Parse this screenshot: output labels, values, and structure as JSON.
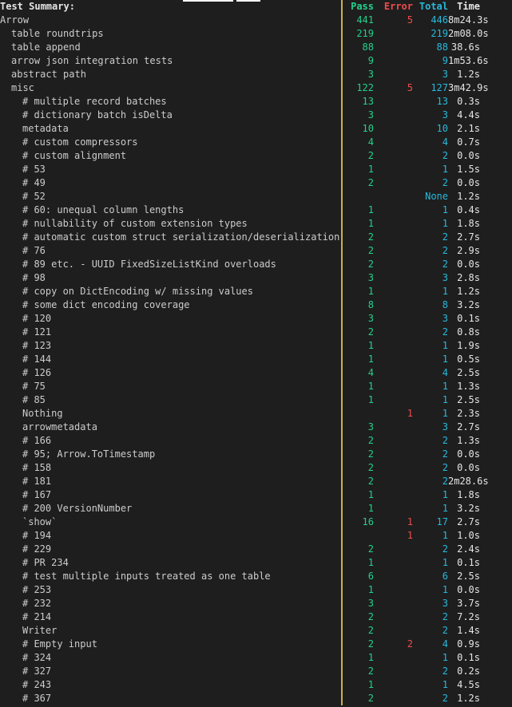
{
  "header": {
    "title": "Test Summary:",
    "pass": "Pass",
    "error": "Error",
    "total": "Total",
    "time": "Time"
  },
  "rows": [
    {
      "name": "Arrow",
      "indent": 0,
      "pass": "441",
      "error": "5",
      "total": "446",
      "time": "8m24.3s"
    },
    {
      "name": "table roundtrips",
      "indent": 1,
      "pass": "219",
      "error": "",
      "total": "219",
      "time": "2m08.0s"
    },
    {
      "name": "table append",
      "indent": 1,
      "pass": "88",
      "error": "",
      "total": "88",
      "time": "38.6s"
    },
    {
      "name": "arrow json integration tests",
      "indent": 1,
      "pass": "9",
      "error": "",
      "total": "9",
      "time": "1m53.6s"
    },
    {
      "name": "abstract path",
      "indent": 1,
      "pass": "3",
      "error": "",
      "total": "3",
      "time": "1.2s"
    },
    {
      "name": "misc",
      "indent": 1,
      "pass": "122",
      "error": "5",
      "total": "127",
      "time": "3m42.9s"
    },
    {
      "name": "# multiple record batches",
      "indent": 2,
      "pass": "13",
      "error": "",
      "total": "13",
      "time": "0.3s"
    },
    {
      "name": "# dictionary batch isDelta",
      "indent": 2,
      "pass": "3",
      "error": "",
      "total": "3",
      "time": "4.4s"
    },
    {
      "name": "metadata",
      "indent": 2,
      "pass": "10",
      "error": "",
      "total": "10",
      "time": "2.1s"
    },
    {
      "name": "# custom compressors",
      "indent": 2,
      "pass": "4",
      "error": "",
      "total": "4",
      "time": "0.7s"
    },
    {
      "name": "# custom alignment",
      "indent": 2,
      "pass": "2",
      "error": "",
      "total": "2",
      "time": "0.0s"
    },
    {
      "name": "# 53",
      "indent": 2,
      "pass": "1",
      "error": "",
      "total": "1",
      "time": "1.5s"
    },
    {
      "name": "# 49",
      "indent": 2,
      "pass": "2",
      "error": "",
      "total": "2",
      "time": "0.0s"
    },
    {
      "name": "# 52",
      "indent": 2,
      "pass": "",
      "error": "",
      "total": "None",
      "time": "1.2s"
    },
    {
      "name": "# 60: unequal column lengths",
      "indent": 2,
      "pass": "1",
      "error": "",
      "total": "1",
      "time": "0.4s"
    },
    {
      "name": "# nullability of custom extension types",
      "indent": 2,
      "pass": "1",
      "error": "",
      "total": "1",
      "time": "1.8s"
    },
    {
      "name": "# automatic custom struct serialization/deserialization",
      "indent": 2,
      "pass": "2",
      "error": "",
      "total": "2",
      "time": "2.7s"
    },
    {
      "name": "# 76",
      "indent": 2,
      "pass": "2",
      "error": "",
      "total": "2",
      "time": "2.9s"
    },
    {
      "name": "# 89 etc. - UUID FixedSizeListKind overloads",
      "indent": 2,
      "pass": "2",
      "error": "",
      "total": "2",
      "time": "0.0s"
    },
    {
      "name": "# 98",
      "indent": 2,
      "pass": "3",
      "error": "",
      "total": "3",
      "time": "2.8s"
    },
    {
      "name": "# copy on DictEncoding w/ missing values",
      "indent": 2,
      "pass": "1",
      "error": "",
      "total": "1",
      "time": "1.2s"
    },
    {
      "name": "# some dict encoding coverage",
      "indent": 2,
      "pass": "8",
      "error": "",
      "total": "8",
      "time": "3.2s"
    },
    {
      "name": "# 120",
      "indent": 2,
      "pass": "3",
      "error": "",
      "total": "3",
      "time": "0.1s"
    },
    {
      "name": "# 121",
      "indent": 2,
      "pass": "2",
      "error": "",
      "total": "2",
      "time": "0.8s"
    },
    {
      "name": "# 123",
      "indent": 2,
      "pass": "1",
      "error": "",
      "total": "1",
      "time": "1.9s"
    },
    {
      "name": "# 144",
      "indent": 2,
      "pass": "1",
      "error": "",
      "total": "1",
      "time": "0.5s"
    },
    {
      "name": "# 126",
      "indent": 2,
      "pass": "4",
      "error": "",
      "total": "4",
      "time": "2.5s"
    },
    {
      "name": "# 75",
      "indent": 2,
      "pass": "1",
      "error": "",
      "total": "1",
      "time": "1.3s"
    },
    {
      "name": "# 85",
      "indent": 2,
      "pass": "1",
      "error": "",
      "total": "1",
      "time": "2.5s"
    },
    {
      "name": "Nothing",
      "indent": 2,
      "pass": "",
      "error": "1",
      "total": "1",
      "time": "2.3s"
    },
    {
      "name": "arrowmetadata",
      "indent": 2,
      "pass": "3",
      "error": "",
      "total": "3",
      "time": "2.7s"
    },
    {
      "name": "# 166",
      "indent": 2,
      "pass": "2",
      "error": "",
      "total": "2",
      "time": "1.3s"
    },
    {
      "name": "# 95; Arrow.ToTimestamp",
      "indent": 2,
      "pass": "2",
      "error": "",
      "total": "2",
      "time": "0.0s"
    },
    {
      "name": "# 158",
      "indent": 2,
      "pass": "2",
      "error": "",
      "total": "2",
      "time": "0.0s"
    },
    {
      "name": "# 181",
      "indent": 2,
      "pass": "2",
      "error": "",
      "total": "2",
      "time": "2m28.6s"
    },
    {
      "name": "# 167",
      "indent": 2,
      "pass": "1",
      "error": "",
      "total": "1",
      "time": "1.8s"
    },
    {
      "name": "# 200 VersionNumber",
      "indent": 2,
      "pass": "1",
      "error": "",
      "total": "1",
      "time": "3.2s"
    },
    {
      "name": "`show`",
      "indent": 2,
      "pass": "16",
      "error": "1",
      "total": "17",
      "time": "2.7s"
    },
    {
      "name": "# 194",
      "indent": 2,
      "pass": "",
      "error": "1",
      "total": "1",
      "time": "1.0s"
    },
    {
      "name": "# 229",
      "indent": 2,
      "pass": "2",
      "error": "",
      "total": "2",
      "time": "2.4s"
    },
    {
      "name": "# PR 234",
      "indent": 2,
      "pass": "1",
      "error": "",
      "total": "1",
      "time": "0.1s"
    },
    {
      "name": "# test multiple inputs treated as one table",
      "indent": 2,
      "pass": "6",
      "error": "",
      "total": "6",
      "time": "2.5s"
    },
    {
      "name": "# 253",
      "indent": 2,
      "pass": "1",
      "error": "",
      "total": "1",
      "time": "0.0s"
    },
    {
      "name": "# 232",
      "indent": 2,
      "pass": "3",
      "error": "",
      "total": "3",
      "time": "3.7s"
    },
    {
      "name": "# 214",
      "indent": 2,
      "pass": "2",
      "error": "",
      "total": "2",
      "time": "7.2s"
    },
    {
      "name": "Writer",
      "indent": 2,
      "pass": "2",
      "error": "",
      "total": "2",
      "time": "1.4s"
    },
    {
      "name": "# Empty input",
      "indent": 2,
      "pass": "2",
      "error": "2",
      "total": "4",
      "time": "0.9s"
    },
    {
      "name": "# 324",
      "indent": 2,
      "pass": "1",
      "error": "",
      "total": "1",
      "time": "0.1s"
    },
    {
      "name": "# 327",
      "indent": 2,
      "pass": "2",
      "error": "",
      "total": "2",
      "time": "0.2s"
    },
    {
      "name": "# 243",
      "indent": 2,
      "pass": "1",
      "error": "",
      "total": "1",
      "time": "4.5s"
    },
    {
      "name": "# 367",
      "indent": 2,
      "pass": "2",
      "error": "",
      "total": "2",
      "time": "1.2s"
    }
  ]
}
